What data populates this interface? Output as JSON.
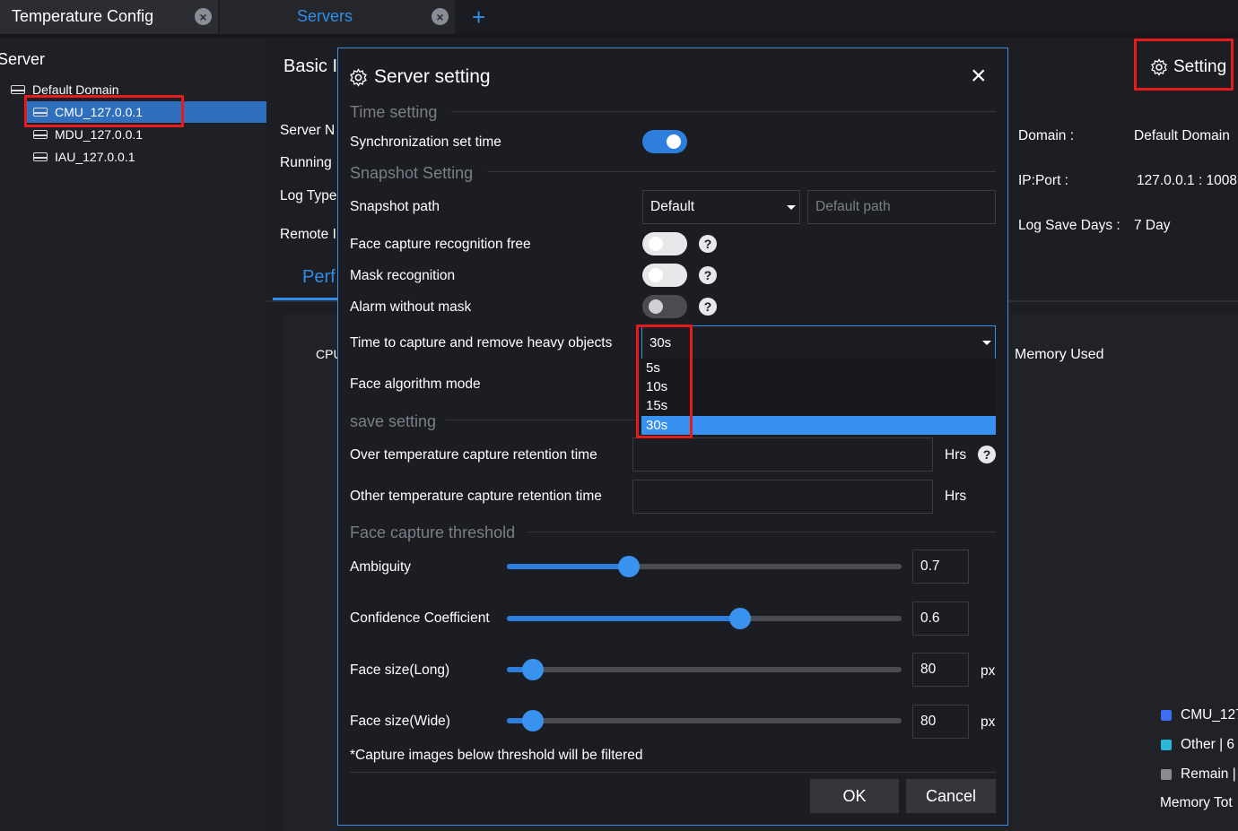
{
  "tabs": [
    {
      "label": "Temperature Config",
      "color": "#ffffff"
    },
    {
      "label": "Servers",
      "color": "#2e8ee8"
    }
  ],
  "tab_add": "+",
  "sidebar": {
    "title": "Server",
    "tree": [
      {
        "label": "Default Domain"
      },
      {
        "label": "CMU_127.0.0.1",
        "selected": true
      },
      {
        "label": "MDU_127.0.0.1"
      },
      {
        "label": "IAU_127.0.0.1"
      }
    ]
  },
  "background": {
    "basic_info_title": "Basic I",
    "setting_button": "Setting",
    "fields_left": [
      "Server N",
      "Running",
      "Log Type",
      "Remote I"
    ],
    "perf_tab": "Perf",
    "cpu_label": "CPU",
    "domain_label": "Domain :",
    "domain_value": "Default Domain",
    "ipport_label": "IP:Port :",
    "ipport_value": "127.0.0.1 : 1008",
    "logdays_label": "Log Save Days :",
    "logdays_value": "7 Day",
    "memory_used": "Memory Used",
    "legend": [
      {
        "label": "CMU_127",
        "color": "#3b6ef5"
      },
      {
        "label": "Other | 6",
        "color": "#2ab7d9"
      },
      {
        "label": "Remain |",
        "color": "#8a8c90"
      }
    ],
    "memory_total": "Memory Tot"
  },
  "modal": {
    "title": "Server setting",
    "close": "×",
    "sections": {
      "time": "Time setting",
      "snapshot": "Snapshot Setting",
      "save": "save setting",
      "threshold": "Face capture threshold"
    },
    "sync_time": {
      "label": "Synchronization set time",
      "on": true
    },
    "snapshot_path": {
      "label": "Snapshot path",
      "select_value": "Default",
      "input_placeholder": "Default path"
    },
    "face_capture_free": {
      "label": "Face capture recognition free",
      "on": false
    },
    "mask_recognition": {
      "label": "Mask recognition",
      "on": false
    },
    "alarm_without_mask": {
      "label": "Alarm without mask",
      "on": false,
      "disabled": true
    },
    "heavy_objects": {
      "label": "Time to capture and remove heavy objects",
      "value": "30s",
      "options": [
        "5s",
        "10s",
        "15s",
        "30s"
      ],
      "selected_index": 3
    },
    "face_algorithm": {
      "label": "Face algorithm mode"
    },
    "over_temp": {
      "label": "Over temperature capture retention time",
      "value": "",
      "unit": "Hrs"
    },
    "other_temp": {
      "label": "Other temperature capture retention time",
      "value": "",
      "unit": "Hrs"
    },
    "sliders": [
      {
        "label": "Ambiguity",
        "value": "0.7",
        "fraction": 0.31,
        "unit": ""
      },
      {
        "label": "Confidence Coefficient",
        "value": "0.6",
        "fraction": 0.59,
        "unit": ""
      },
      {
        "label": "Face size(Long)",
        "value": "80",
        "fraction": 0.065,
        "unit": "px"
      },
      {
        "label": "Face size(Wide)",
        "value": "80",
        "fraction": 0.065,
        "unit": "px"
      }
    ],
    "note": "*Capture images below threshold will be filtered",
    "ok": "OK",
    "cancel": "Cancel"
  }
}
